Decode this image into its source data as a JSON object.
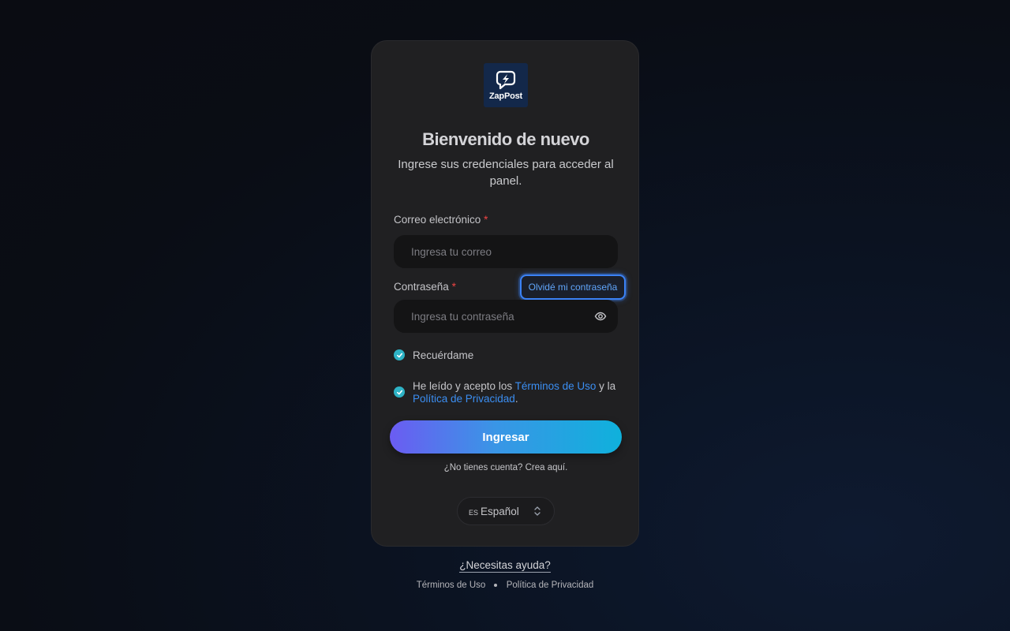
{
  "logo": {
    "text": "ZapPost",
    "icon": "chat-bolt-icon",
    "background": "#13284a"
  },
  "header": {
    "title": "Bienvenido de nuevo",
    "subtitle": "Ingrese sus credenciales para acceder al panel."
  },
  "form": {
    "email": {
      "label": "Correo electrónico",
      "required_mark": "*",
      "placeholder": "Ingresa tu correo",
      "value": ""
    },
    "password": {
      "label": "Contraseña",
      "required_mark": "*",
      "placeholder": "Ingresa tu contraseña",
      "value": "",
      "toggle_icon": "eye-icon"
    },
    "forgot_label": "Olvidé mi contraseña",
    "remember": {
      "label": "Recuérdame",
      "checked": true
    },
    "terms": {
      "checked": true,
      "prefix": "He leído y acepto los ",
      "terms_link": "Términos de Uso",
      "middle": " y la ",
      "privacy_link": "Política de Privacidad",
      "suffix": "."
    },
    "submit_label": "Ingresar",
    "signup_text": "¿No tienes cuenta? Crea aquí."
  },
  "language": {
    "code": "ES",
    "label": "Español",
    "icon": "chevron-up-down-icon"
  },
  "footer": {
    "help": "¿Necesitas ayuda?",
    "terms": "Términos de Uso",
    "privacy": "Política de Privacidad"
  },
  "colors": {
    "accent": "#3b82f6",
    "link": "#3b8ef2",
    "check": "#2eb3c6",
    "button_gradient_start": "#6b5cf2",
    "button_gradient_end": "#0fb1dc",
    "required": "#ef4444"
  }
}
